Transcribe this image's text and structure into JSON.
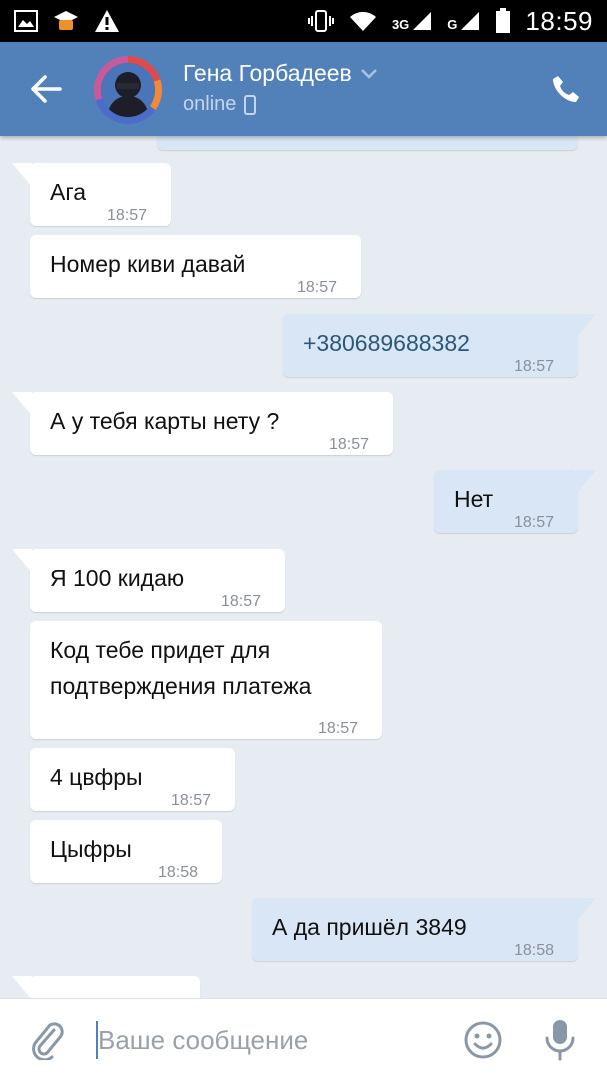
{
  "status_bar": {
    "network_3g": "3G",
    "network_g": "G",
    "time": "18:59"
  },
  "header": {
    "contact_name": "Гена Горбадеев",
    "status": "online",
    "accent": "#5181b8"
  },
  "messages": [
    {
      "direction": "in",
      "text": "Ага",
      "time": "18:57"
    },
    {
      "direction": "in",
      "text": "Номер киви давай",
      "time": "18:57"
    },
    {
      "direction": "out",
      "text": "+380689688382",
      "time": "18:57"
    },
    {
      "direction": "in",
      "text": "А у тебя карты нету ?",
      "time": "18:57"
    },
    {
      "direction": "out",
      "text": "Нет",
      "time": "18:57"
    },
    {
      "direction": "in",
      "text": "Я 100 кидаю",
      "time": "18:57"
    },
    {
      "direction": "in",
      "text_line1": "Код тебе придет для",
      "text_line2": "подтверждения платежа",
      "time": "18:57"
    },
    {
      "direction": "in",
      "text": "4 цвфры",
      "time": "18:57"
    },
    {
      "direction": "in",
      "text": "Цыфры",
      "time": "18:58"
    },
    {
      "direction": "out",
      "text": "А да пришёл 3849",
      "time": "18:58"
    }
  ],
  "composer": {
    "placeholder": "Ваше сообщение"
  },
  "icons": {
    "back": "arrow-left-icon",
    "call": "phone-icon",
    "attach": "paperclip-icon",
    "emoji": "smiley-icon",
    "mic": "microphone-icon"
  }
}
